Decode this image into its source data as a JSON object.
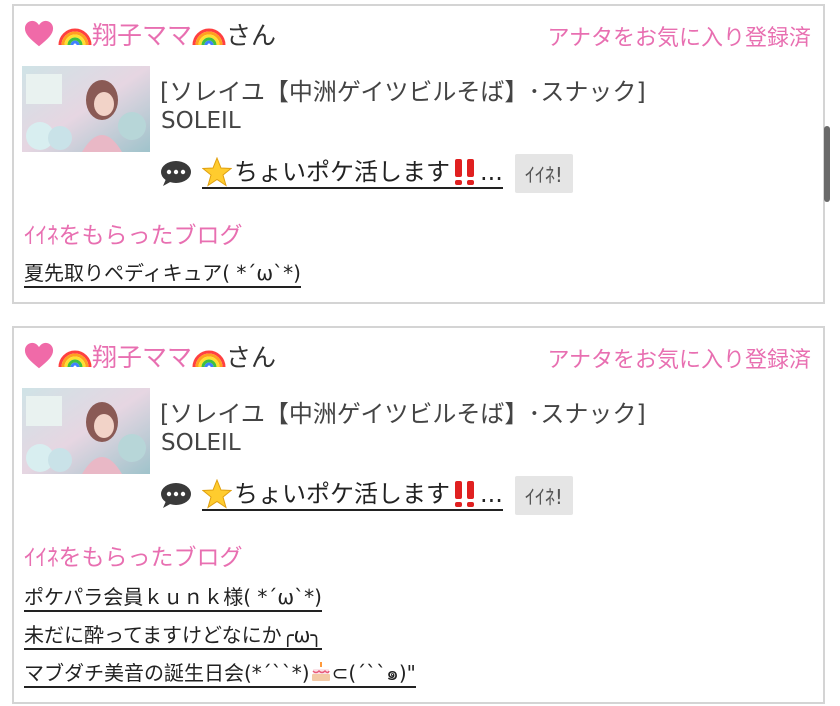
{
  "cards": [
    {
      "user_name": "翔子ママ",
      "name_suffix": "さん",
      "fav_status": "アナタをお気に入り登録済",
      "shop_name": "[ソレイユ【中洲ゲイツビルそば】･スナック]",
      "shop_sub": "SOLEIL",
      "post_title": "ちょいポケ活します",
      "post_ellipsis": "...",
      "like_label": "ｲｲﾈ!",
      "section_title": "ｲｲﾈをもらったブログ",
      "blogs": [
        "夏先取りペディキュア( *´ω`*)"
      ]
    },
    {
      "user_name": "翔子ママ",
      "name_suffix": "さん",
      "fav_status": "アナタをお気に入り登録済",
      "shop_name": "[ソレイユ【中洲ゲイツビルそば】･スナック]",
      "shop_sub": "SOLEIL",
      "post_title": "ちょいポケ活します",
      "post_ellipsis": "...",
      "like_label": "ｲｲﾈ!",
      "section_title": "ｲｲﾈをもらったブログ",
      "blogs": [
        "ポケパラ会員ｋｕｎｋ様( *´ω`*)",
        "未だに酔ってますけどなにか╭ω╮",
        "マブダチ美音の誕生日会(*´``*)",
        "⊂(´``๑)\""
      ]
    }
  ],
  "icons": {
    "heart": "heart-icon",
    "rainbow": "rainbow-icon",
    "speech": "speech-bubble-icon",
    "star": "star-icon",
    "bang": "double-exclamation-icon",
    "cake": "birthday-cake-icon"
  },
  "colors": {
    "accent_pink": "#e86fb1",
    "border": "#d4d4d4",
    "like_bg": "#e5e5e5"
  }
}
